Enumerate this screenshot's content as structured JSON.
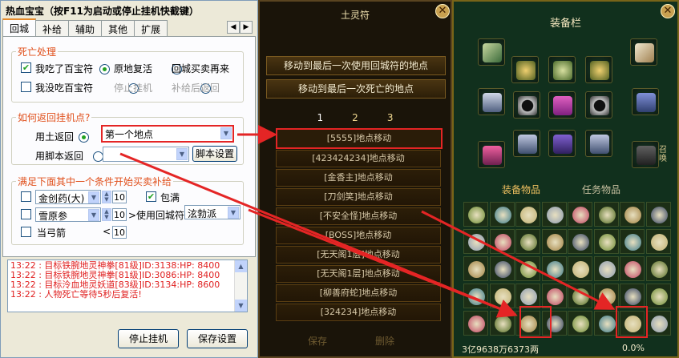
{
  "dialog": {
    "title": "热血宝宝（按F11为启动或停止挂机快截键）",
    "tabs": [
      "回城",
      "补给",
      "辅助",
      "其他",
      "扩展"
    ],
    "death": {
      "title": "死亡处理",
      "ate_label": "我吃了百宝符",
      "revive_label": "原地复活",
      "buy_label": "回城买卖再来",
      "notate_label": "我没吃百宝符",
      "stop_label": "停止挂机",
      "supply_label": "补给后返回"
    },
    "return": {
      "title": "如何返回挂机点?",
      "earth_label": "用土返回",
      "earth_value": "第一个地点",
      "script_label": "用脚本返回",
      "script_value": "",
      "script_btn": "脚本设置"
    },
    "supply": {
      "title": "满足下面其中一个条件开始买卖补给",
      "rows": [
        {
          "label": "金创药(大)",
          "value": "10"
        },
        {
          "label": "雪原参",
          "value": "10"
        },
        {
          "label": "当弓箭",
          "value": "10"
        }
      ],
      "full_label": "包满",
      "use_label": ">使用回城符",
      "faction": "泫勃派"
    },
    "log": [
      "13:22 : 目标铁腕地灵神拳[81级]ID:3138:HP: 8400",
      "13:22 : 目标铁腕地灵神拳[81级]ID:3086:HP: 8400",
      "13:22 : 目标泠血地灵妖道[83级]ID:3134:HP: 8600",
      "13:22 : 人物死亡等待5秒后复活!"
    ],
    "stop_btn": "停止挂机",
    "save_btn": "保存设置"
  },
  "middle": {
    "title": "土灵符",
    "bar1": "移动到最后一次使用回城符的地点",
    "bar2": "移动到最后一次死亡的地点",
    "pages": [
      "1",
      "2",
      "3"
    ],
    "locations": [
      "[5555]地点移动",
      "[423424234]地点移动",
      "[金香主]地点移动",
      "[刀剑笑]地点移动",
      "[不安全怪]地点移动",
      "[BOSS]地点移动",
      "[无天阁1层]地点移动",
      "[无天阁1层]地点移动",
      "[柳善府蛇]地点移动",
      "[324234]地点移动"
    ],
    "save": "保存",
    "delete": "删除"
  },
  "right": {
    "title": "装备栏",
    "tab_equip": "装备物品",
    "tab_quest": "任务物品",
    "side_label": "召唤",
    "money": "3亿9638万6373两",
    "pct": "0.0%",
    "colors": {
      "accent": "#d4b030",
      "red": "#e42525"
    }
  }
}
